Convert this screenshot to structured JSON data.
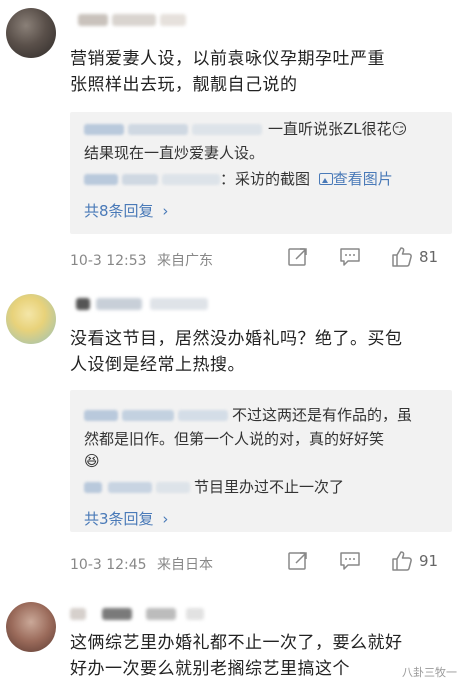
{
  "comments": [
    {
      "text_line1": "营销爱妻人设，以前袁咏仪孕期孕吐严重",
      "text_line2": "张照样出去玩，靓靓自己说的",
      "replies": {
        "r1_tail": "一直听说张ZL很花",
        "r1_emoji": "😏",
        "r1_line2": "结果现在一直炒爱妻人设。",
        "r2_tail": "：采访的截图",
        "r2_link": "查看图片",
        "more": "共8条回复",
        "more_chev": "›"
      },
      "time": "10-3 12:53",
      "location": "来自广东",
      "likes": "81"
    },
    {
      "text_line1": "没看这节目，居然没办婚礼吗？绝了。买包",
      "text_line2": "人设倒是经常上热搜。",
      "replies": {
        "r1_tail": "不过这两还是有作品的，虽",
        "r1_line2": "然都是旧作。但第一个人说的对，真的好好笑",
        "r1_emoji": "😆",
        "r2_tail": "节目里办过不止一次了",
        "more": "共3条回复",
        "more_chev": "›"
      },
      "time": "10-3 12:45",
      "location": "来自日本",
      "likes": "91"
    },
    {
      "text_line1": "这俩综艺里办婚礼都不止一次了，要么就好",
      "text_line2": "好办一次要么就别老搁综艺里搞这个"
    }
  ],
  "icons": [
    "share-icon",
    "comment-icon",
    "like-icon"
  ],
  "watermark": "八卦三牧一",
  "colors": {
    "link": "#4a7ab8",
    "reply_bg": "#f2f2f2",
    "meta": "#888888"
  }
}
